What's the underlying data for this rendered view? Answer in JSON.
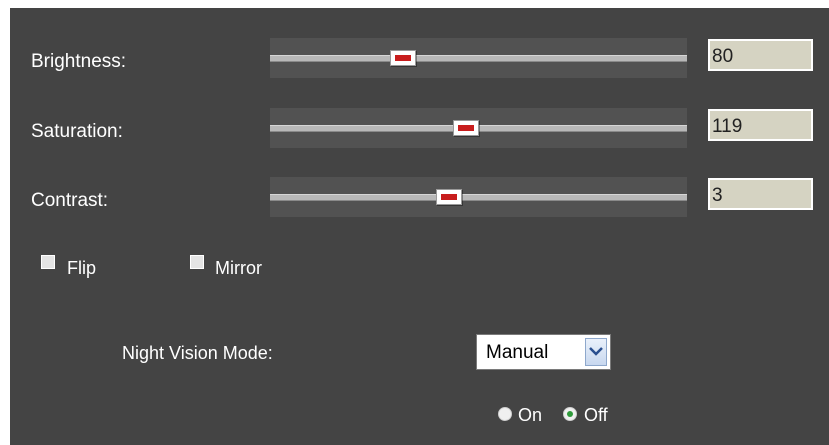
{
  "adjustments": {
    "brightness": {
      "label": "Brightness:",
      "value": "80",
      "position": 0.32
    },
    "saturation": {
      "label": "Saturation:",
      "value": "119",
      "position": 0.47
    },
    "contrast": {
      "label": "Contrast:",
      "value": "3",
      "position": 0.43
    }
  },
  "options": {
    "flip": {
      "label": "Flip",
      "checked": false
    },
    "mirror": {
      "label": "Mirror",
      "checked": false
    }
  },
  "night_vision": {
    "label": "Night Vision Mode:",
    "selected": "Manual",
    "radios": [
      {
        "label": "On",
        "checked": false
      },
      {
        "label": "Off",
        "checked": true
      }
    ]
  },
  "colors": {
    "panel_bg": "#444444",
    "slider_bg": "#525252",
    "thumb_accent": "#c81d1d",
    "value_box_bg": "#d5d3c2",
    "radio_selected": "#2e9a3a"
  },
  "icons": {
    "select_arrow": "chevron-down-icon"
  }
}
